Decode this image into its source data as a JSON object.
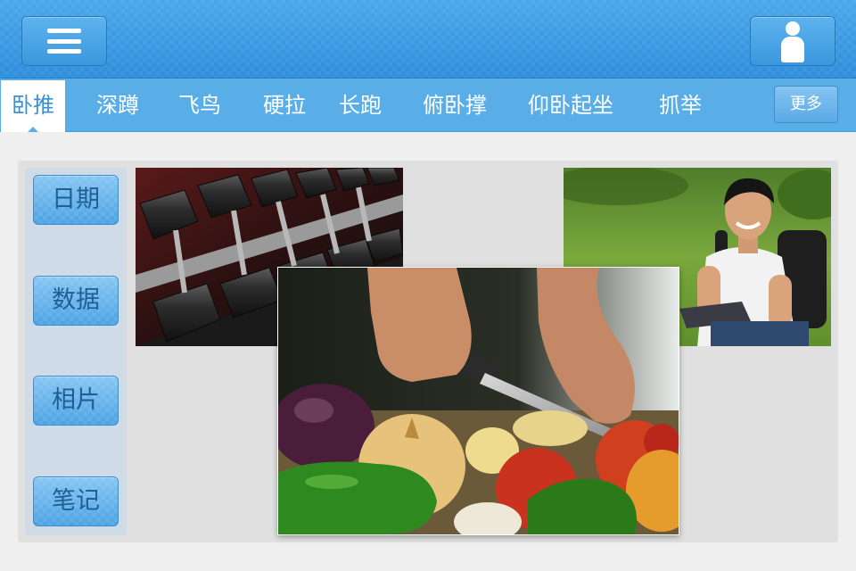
{
  "header": {
    "menu_icon": "hamburger-menu-icon",
    "user_icon": "user-profile-icon",
    "color": "#3a9ae3"
  },
  "tabs": [
    {
      "label": "卧推",
      "active": true
    },
    {
      "label": "深蹲",
      "active": false
    },
    {
      "label": "飞鸟",
      "active": false
    },
    {
      "label": "硬拉",
      "active": false
    },
    {
      "label": "长跑",
      "active": false
    },
    {
      "label": "俯卧撑",
      "active": false
    },
    {
      "label": "仰卧起坐",
      "active": false
    },
    {
      "label": "抓举",
      "active": false
    }
  ],
  "more_label": "更多",
  "sidebar": {
    "items": [
      {
        "label": "日期"
      },
      {
        "label": "数据"
      },
      {
        "label": "相片"
      },
      {
        "label": "笔记"
      }
    ]
  },
  "photos": [
    {
      "subject": "dumbbell-rack"
    },
    {
      "subject": "smiling-student-with-backpack"
    },
    {
      "subject": "hands-cutting-vegetables"
    }
  ]
}
